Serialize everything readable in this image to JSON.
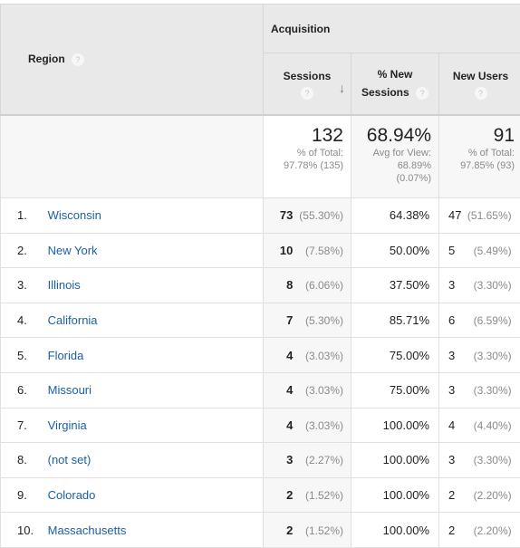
{
  "header": {
    "region_label": "Region",
    "group_label": "Acquisition",
    "columns": [
      {
        "label_line1": "Sessions",
        "label_line2": "",
        "sorted": "descending"
      },
      {
        "label_line1": "% New",
        "label_line2": "Sessions"
      },
      {
        "label_line1": "New Users",
        "label_line2": ""
      }
    ],
    "help_glyph": "?",
    "sort_glyph": "↓"
  },
  "totals": {
    "sessions": {
      "value": "132",
      "line1": "% of Total:",
      "line2": "97.78% (135)"
    },
    "new_sessions_pct": {
      "value": "68.94%",
      "line1": "Avg for View:",
      "line2": "68.89%",
      "line3": "(0.07%)"
    },
    "new_users": {
      "value": "91",
      "line1": "% of Total:",
      "line2": "97.85% (93)"
    }
  },
  "rows": [
    {
      "index": "1.",
      "region": "Wisconsin",
      "sessions": "73",
      "sessions_pct": "(55.30%)",
      "new_sessions_pct": "64.38%",
      "new_users": "47",
      "new_users_pct": "(51.65%)"
    },
    {
      "index": "2.",
      "region": "New York",
      "sessions": "10",
      "sessions_pct": "(7.58%)",
      "new_sessions_pct": "50.00%",
      "new_users": "5",
      "new_users_pct": "(5.49%)"
    },
    {
      "index": "3.",
      "region": "Illinois",
      "sessions": "8",
      "sessions_pct": "(6.06%)",
      "new_sessions_pct": "37.50%",
      "new_users": "3",
      "new_users_pct": "(3.30%)"
    },
    {
      "index": "4.",
      "region": "California",
      "sessions": "7",
      "sessions_pct": "(5.30%)",
      "new_sessions_pct": "85.71%",
      "new_users": "6",
      "new_users_pct": "(6.59%)"
    },
    {
      "index": "5.",
      "region": "Florida",
      "sessions": "4",
      "sessions_pct": "(3.03%)",
      "new_sessions_pct": "75.00%",
      "new_users": "3",
      "new_users_pct": "(3.30%)"
    },
    {
      "index": "6.",
      "region": "Missouri",
      "sessions": "4",
      "sessions_pct": "(3.03%)",
      "new_sessions_pct": "75.00%",
      "new_users": "3",
      "new_users_pct": "(3.30%)"
    },
    {
      "index": "7.",
      "region": "Virginia",
      "sessions": "4",
      "sessions_pct": "(3.03%)",
      "new_sessions_pct": "100.00%",
      "new_users": "4",
      "new_users_pct": "(4.40%)"
    },
    {
      "index": "8.",
      "region": "(not set)",
      "sessions": "3",
      "sessions_pct": "(2.27%)",
      "new_sessions_pct": "100.00%",
      "new_users": "3",
      "new_users_pct": "(3.30%)"
    },
    {
      "index": "9.",
      "region": "Colorado",
      "sessions": "2",
      "sessions_pct": "(1.52%)",
      "new_sessions_pct": "100.00%",
      "new_users": "2",
      "new_users_pct": "(2.20%)"
    },
    {
      "index": "10.",
      "region": "Massachusetts",
      "sessions": "2",
      "sessions_pct": "(1.52%)",
      "new_sessions_pct": "100.00%",
      "new_users": "2",
      "new_users_pct": "(2.20%)"
    }
  ]
}
